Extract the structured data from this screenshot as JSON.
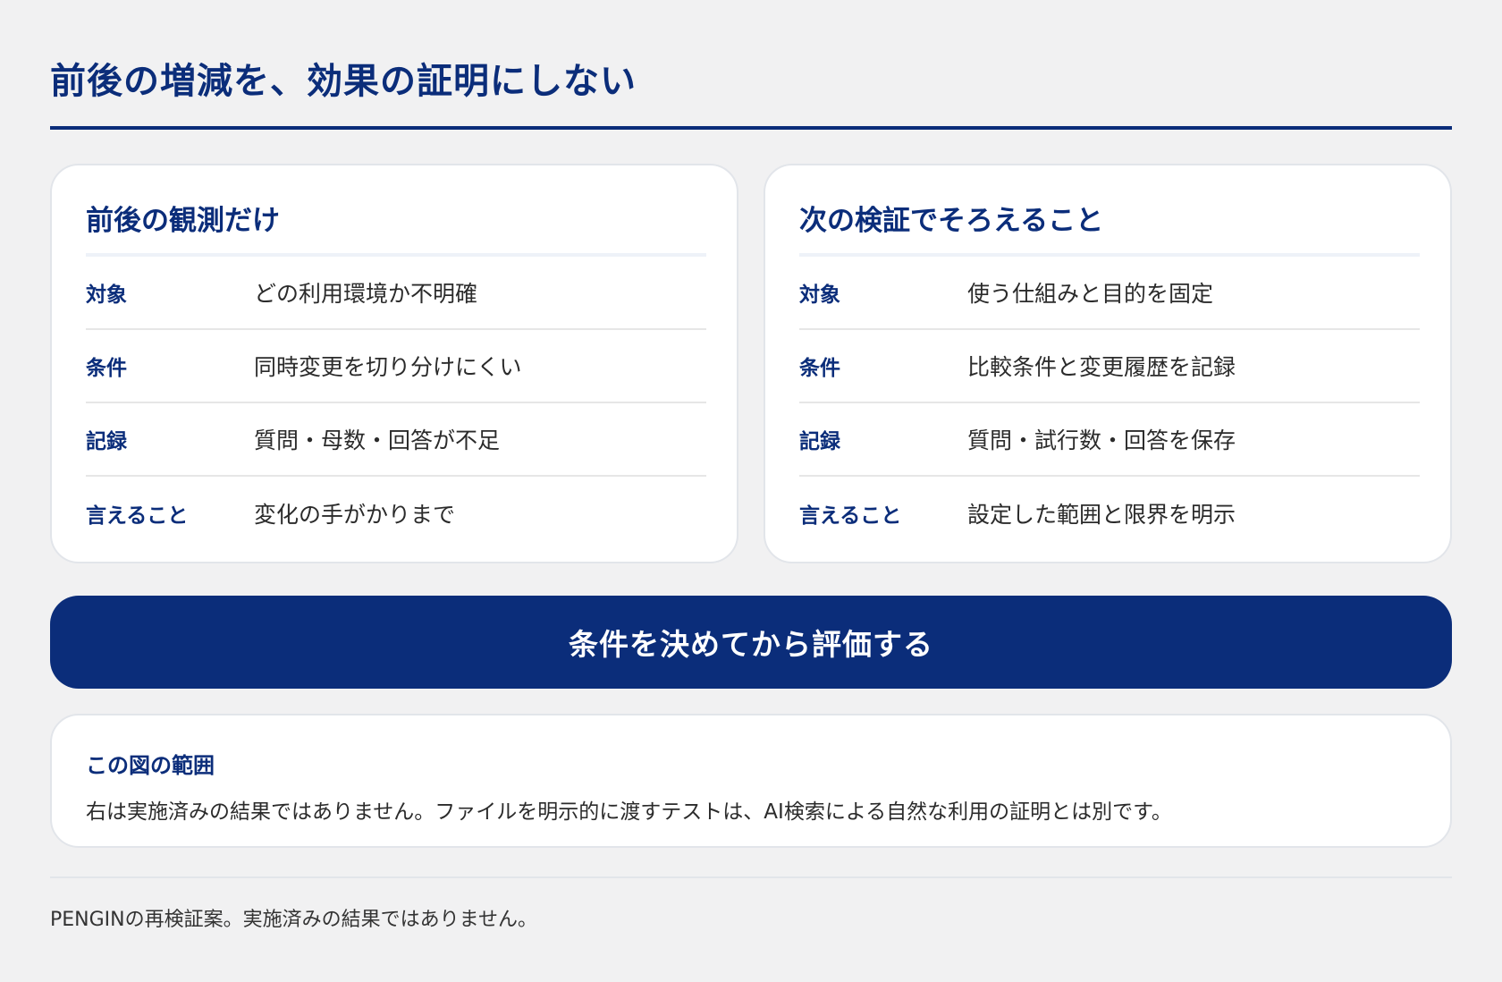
{
  "page": {
    "title": "前後の増減を、効果の証明にしない"
  },
  "left_card": {
    "heading": "前後の観測だけ",
    "rows": [
      {
        "label": "対象",
        "value": "どの利用環境か不明確"
      },
      {
        "label": "条件",
        "value": "同時変更を切り分けにくい"
      },
      {
        "label": "記録",
        "value": "質問・母数・回答が不足"
      },
      {
        "label": "言えること",
        "value": "変化の手がかりまで"
      }
    ]
  },
  "right_card": {
    "heading": "次の検証でそろえること",
    "rows": [
      {
        "label": "対象",
        "value": "使う仕組みと目的を固定"
      },
      {
        "label": "条件",
        "value": "比較条件と変更履歴を記録"
      },
      {
        "label": "記録",
        "value": "質問・試行数・回答を保存"
      },
      {
        "label": "言えること",
        "value": "設定した範囲と限界を明示"
      }
    ]
  },
  "cta": {
    "label": "条件を決めてから評価する"
  },
  "scope": {
    "title": "この図の範囲",
    "text": "右は実施済みの結果ではありません。ファイルを明示的に渡すテストは、AI検索による自然な利用の証明とは別です。"
  },
  "footer": {
    "text": "PENGINの再検証案。実施済みの結果ではありません。"
  },
  "colors": {
    "accent": "#0b2d7a",
    "background": "#f1f1f2",
    "card": "#ffffff"
  }
}
